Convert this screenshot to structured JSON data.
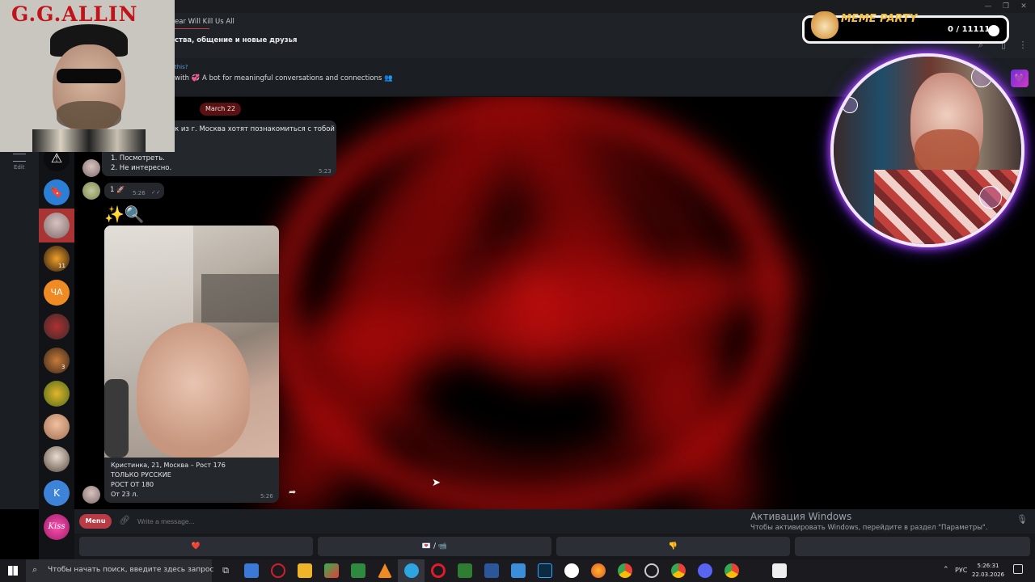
{
  "window": {
    "minimize_glyph": "—",
    "restore_glyph": "❐",
    "close_glyph": "✕"
  },
  "chat_header": {
    "title": "ear Will Kill Us All",
    "subtitle": "ства, общение и новые друзья"
  },
  "pinned": {
    "tag": "this?",
    "text_prefix": "with",
    "text_main": "A bot for meaningful conversations and connections"
  },
  "sidebar": {
    "edit_label": "Edit",
    "folders": [
      {
        "name": "warning",
        "badge": ""
      },
      {
        "name": "saved",
        "badge": ""
      },
      {
        "name": "chat-1",
        "badge": ""
      },
      {
        "name": "chat-2",
        "badge": "11"
      },
      {
        "name": "chat-ча",
        "label": "ЧА",
        "badge": ""
      },
      {
        "name": "chat-4",
        "badge": ""
      },
      {
        "name": "chat-5",
        "badge": "3"
      },
      {
        "name": "chat-6",
        "badge": ""
      },
      {
        "name": "chat-7",
        "badge": ""
      },
      {
        "name": "chat-8",
        "badge": ""
      },
      {
        "name": "chat-k",
        "label": "K",
        "badge": ""
      },
      {
        "name": "chat-kiss",
        "label": "Kiss",
        "badge": ""
      }
    ]
  },
  "messages": {
    "date": "March 22",
    "msg1_line1": "к из г. Москва хотят познакомиться с тобой",
    "msg1_line2": "1. Посмотреть.",
    "msg1_line3": "2. Не интересно.",
    "msg1_time": "5:23",
    "msg2_text": "1",
    "msg2_time": "5:26",
    "emoji_line": "✨🔍",
    "card_caption_1": "Кристинка, 21, Москва – Рост 176",
    "card_caption_2": "ТОЛЬКО РУССКИЕ",
    "card_caption_3": "РОСТ ОТ 180",
    "card_caption_4": "От 23 л.",
    "card_time": "5:26"
  },
  "composer": {
    "menu_label": "Menu",
    "placeholder": "Write a message..."
  },
  "keyboard": {
    "btn1": "❤️",
    "btn2": "💌 / 📹",
    "btn3": "👎",
    "btn4": ""
  },
  "activation": {
    "title": "Активация Windows",
    "text": "Чтобы активировать Windows, перейдите в раздел \"Параметры\"."
  },
  "taskbar": {
    "search_text": "Чтобы начать поиск, введите здесь запрос",
    "lang": "РУС",
    "time": "5:26:31",
    "date": "22.03.2026"
  },
  "overlays": {
    "gg_title": "G.G.ALLIN",
    "meme_title": "MEME PARTY",
    "meme_count": "0 / 111111"
  },
  "colors": {
    "accent_red": "#b83b45",
    "glow_red": "#d41515",
    "meme_gold": "#f6c03e",
    "webcam_ring": "#c04bff"
  }
}
